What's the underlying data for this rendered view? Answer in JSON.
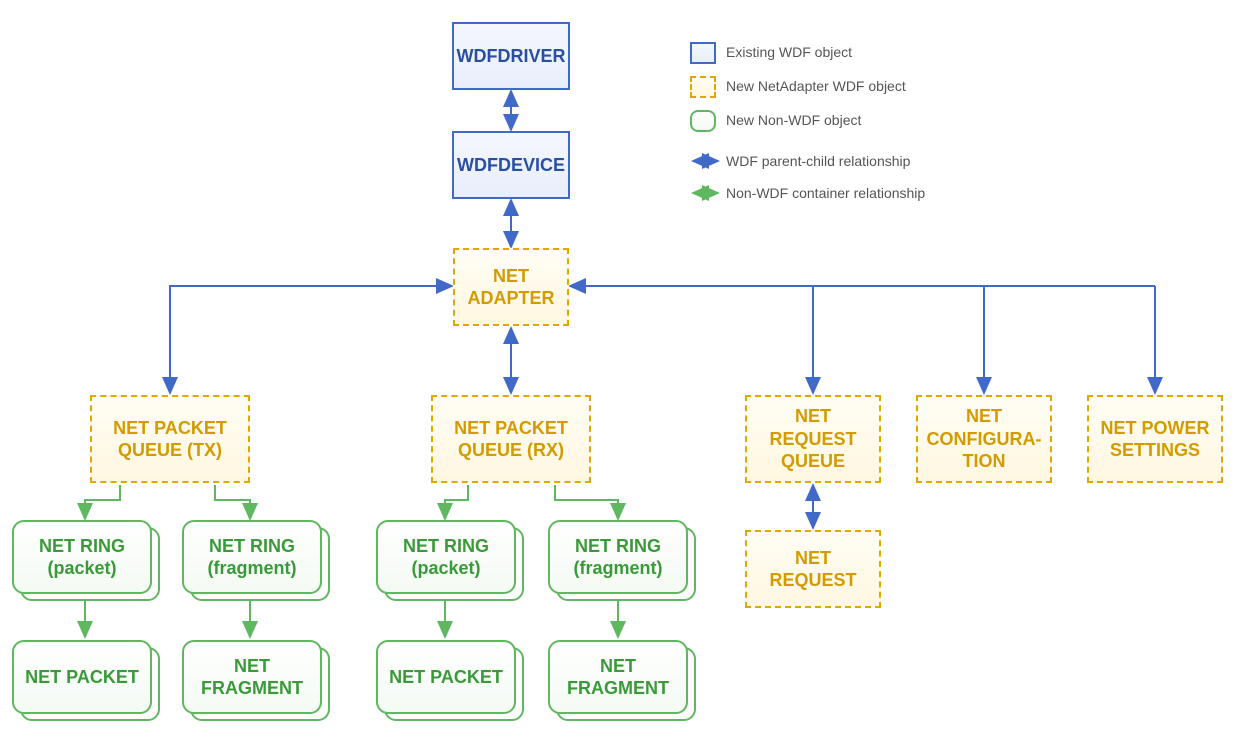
{
  "nodes": {
    "wdfdriver": "WDFDRIVER",
    "wdfdevice": "WDFDEVICE",
    "netadapter": "NET ADAPTER",
    "pkt_tx": "NET PACKET QUEUE (TX)",
    "pkt_rx": "NET PACKET QUEUE (RX)",
    "req_queue": "NET REQUEST QUEUE",
    "config": "NET CONFIGURA-TION",
    "power": "NET POWER SETTINGS",
    "ring_pkt_tx": "NET RING (packet)",
    "ring_frag_tx": "NET RING (fragment)",
    "ring_pkt_rx": "NET RING (packet)",
    "ring_frag_rx": "NET RING (fragment)",
    "pkt_tx_leaf": "NET PACKET",
    "frag_tx_leaf": "NET FRAGMENT",
    "pkt_rx_leaf": "NET PACKET",
    "frag_rx_leaf": "NET FRAGMENT",
    "net_request": "NET REQUEST"
  },
  "legend": {
    "existing": "Existing WDF object",
    "newnet": "New NetAdapter WDF object",
    "newnon": "New Non-WDF object",
    "wdf_rel": "WDF parent-child relationship",
    "non_rel": "Non-WDF container relationship"
  },
  "colors": {
    "blue": "#4169c8",
    "orange": "#e0a800",
    "green": "#5fb85f"
  }
}
